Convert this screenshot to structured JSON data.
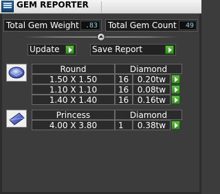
{
  "window": {
    "title": "GEM REPORTER"
  },
  "stats": {
    "total_weight_label": "Total Gem Weight",
    "total_weight_value": ".83",
    "total_count_label": "Total Gem Count",
    "total_count_value": "49"
  },
  "actions": {
    "update_label": "Update",
    "save_report_label": "Save Report"
  },
  "groups": [
    {
      "cut": "Round",
      "type": "Diamond",
      "rows": [
        {
          "size": "1.50 X 1.50",
          "count": "16",
          "weight": "0.20tw"
        },
        {
          "size": "1.10 X 1.10",
          "count": "16",
          "weight": "0.08tw"
        },
        {
          "size": "1.40 X 1.40",
          "count": "16",
          "weight": "0.16tw"
        }
      ]
    },
    {
      "cut": "Princess",
      "type": "Diamond",
      "rows": [
        {
          "size": "4.00 X 3.80",
          "count": "1",
          "weight": "0.38tw"
        }
      ]
    }
  ],
  "icons": {
    "app": "gem-reporter-app-icon",
    "collapse": "collapse-up-icon",
    "go": "green-arrow-right-icon",
    "round_gem": "round-gem-icon",
    "princess_gem": "princess-gem-icon"
  },
  "colors": {
    "background": "#3c3c3c",
    "go_button": "#3fa52a",
    "value_text": "#8fd0e6"
  }
}
